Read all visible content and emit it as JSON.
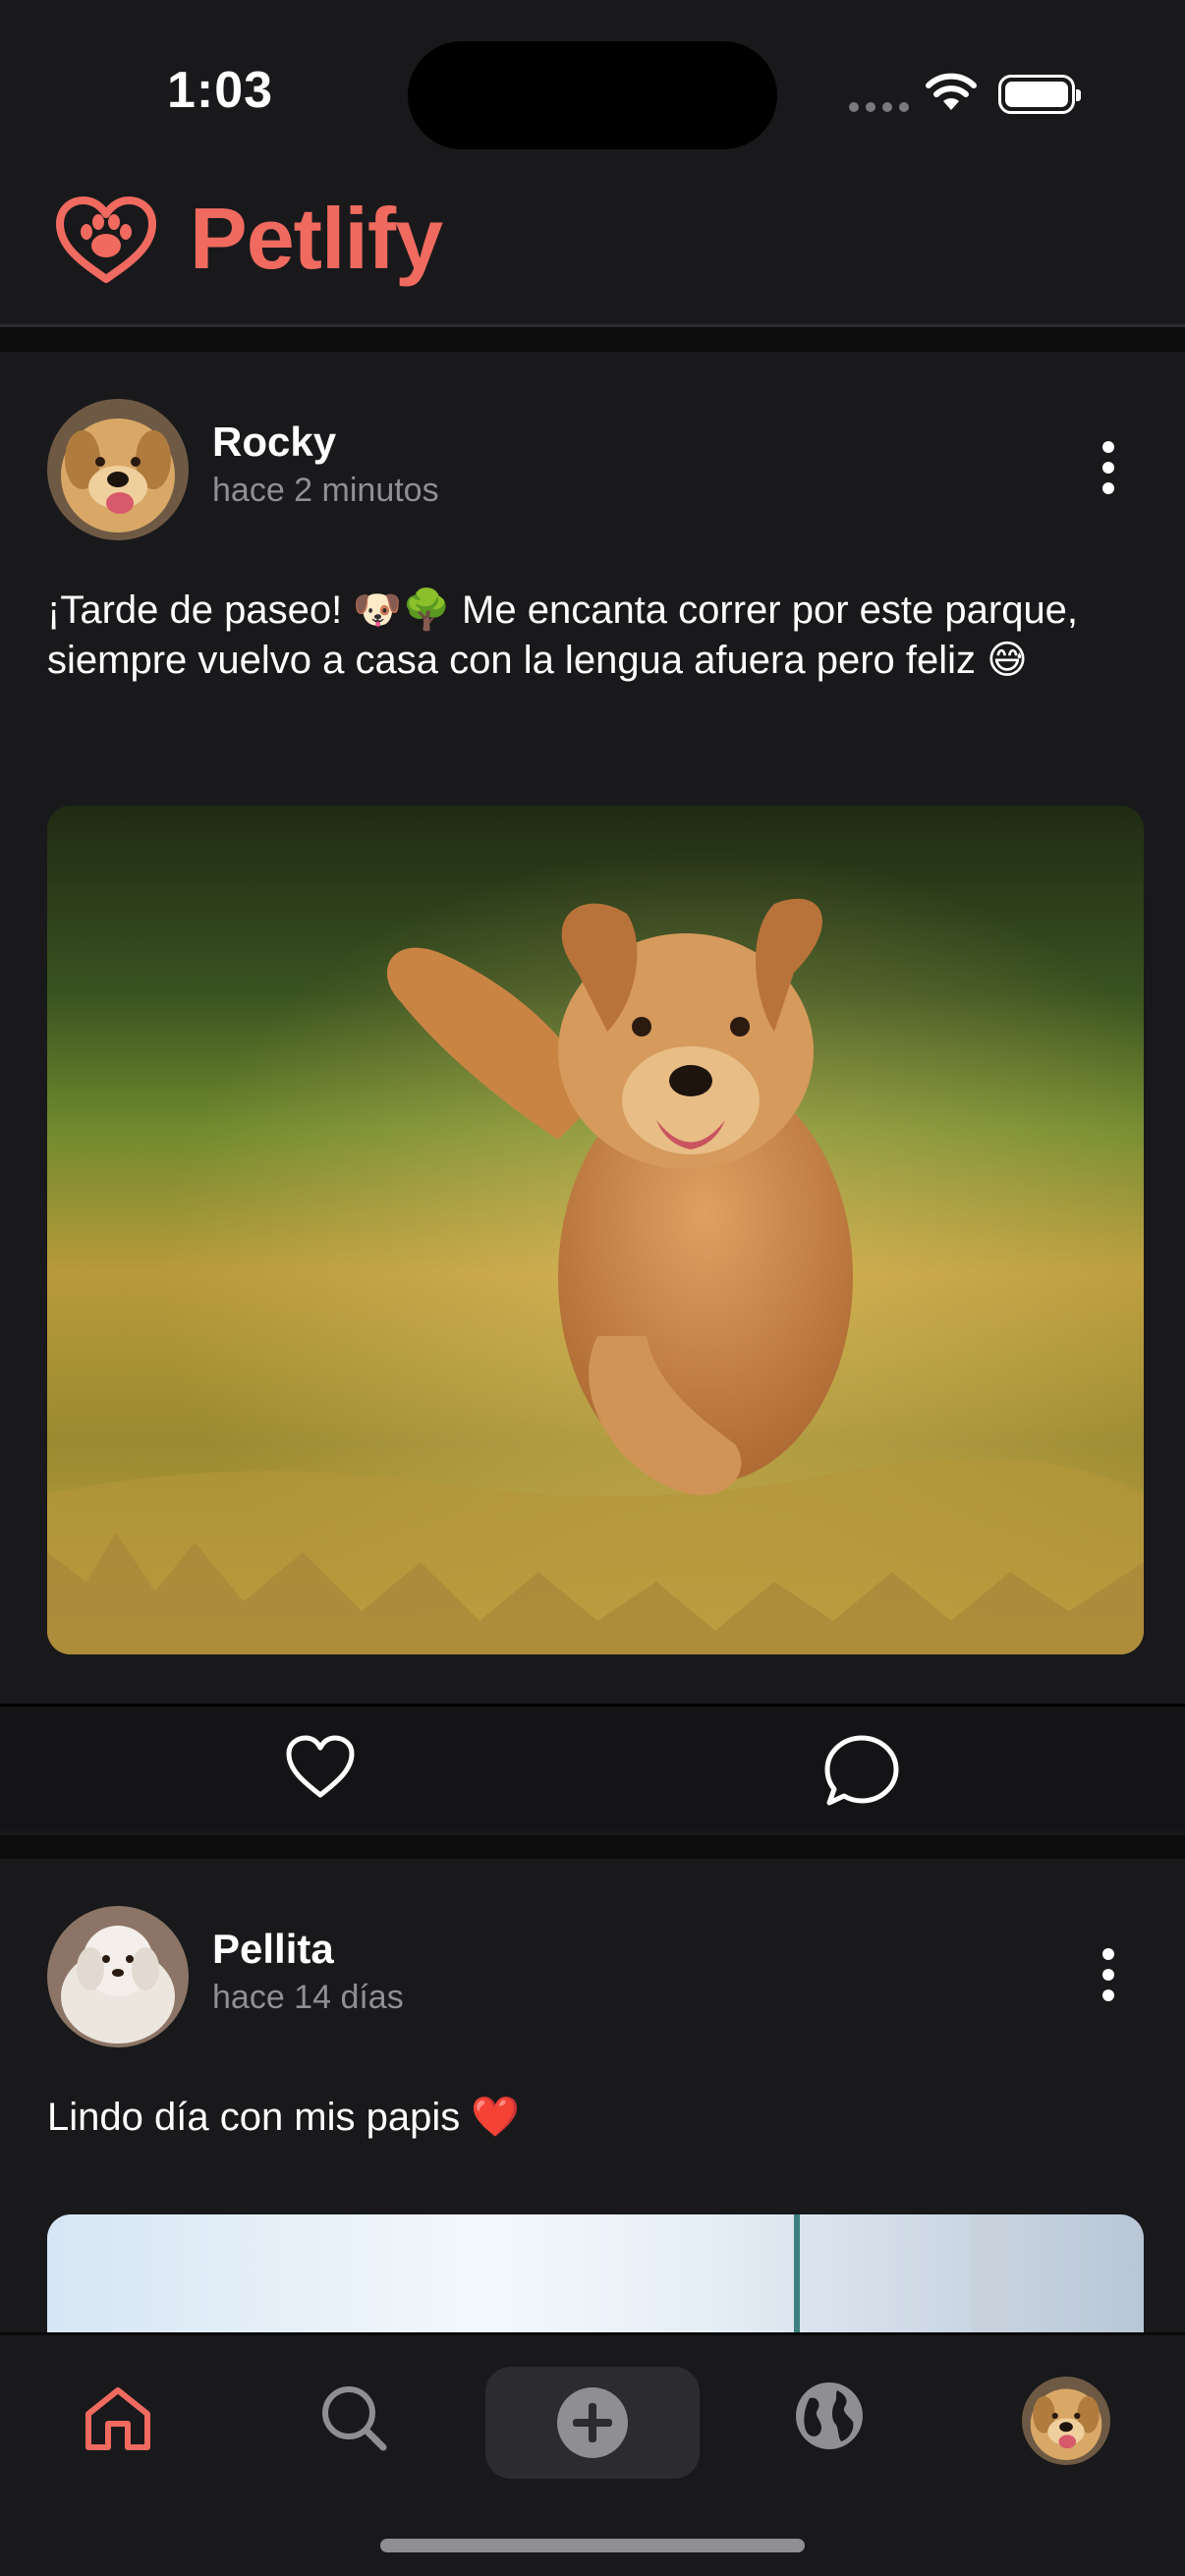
{
  "status_bar": {
    "time": "1:03"
  },
  "app": {
    "title": "Petlify",
    "accent_color": "#f06a5f",
    "logo_icon": "paw-heart-icon"
  },
  "posts": [
    {
      "author": "Rocky",
      "time": "hace 2 minutos",
      "text": "¡Tarde de paseo! 🐶🌳 Me encanta correr por este parque, siempre vuelvo a casa con la lengua afuera pero feliz 😅",
      "image": "golden-retriever-running-in-park-photo",
      "actions": [
        "heart-icon",
        "comment-icon"
      ]
    },
    {
      "author": "Pellita",
      "time": "hace 14 días",
      "text": "Lindo día con mis papis ❤️",
      "image": "window-light-photo"
    }
  ],
  "tab_bar": {
    "items": [
      "home-icon",
      "search-icon",
      "add-post-icon",
      "globe-icon",
      "profile-avatar"
    ],
    "active": "home-icon"
  }
}
